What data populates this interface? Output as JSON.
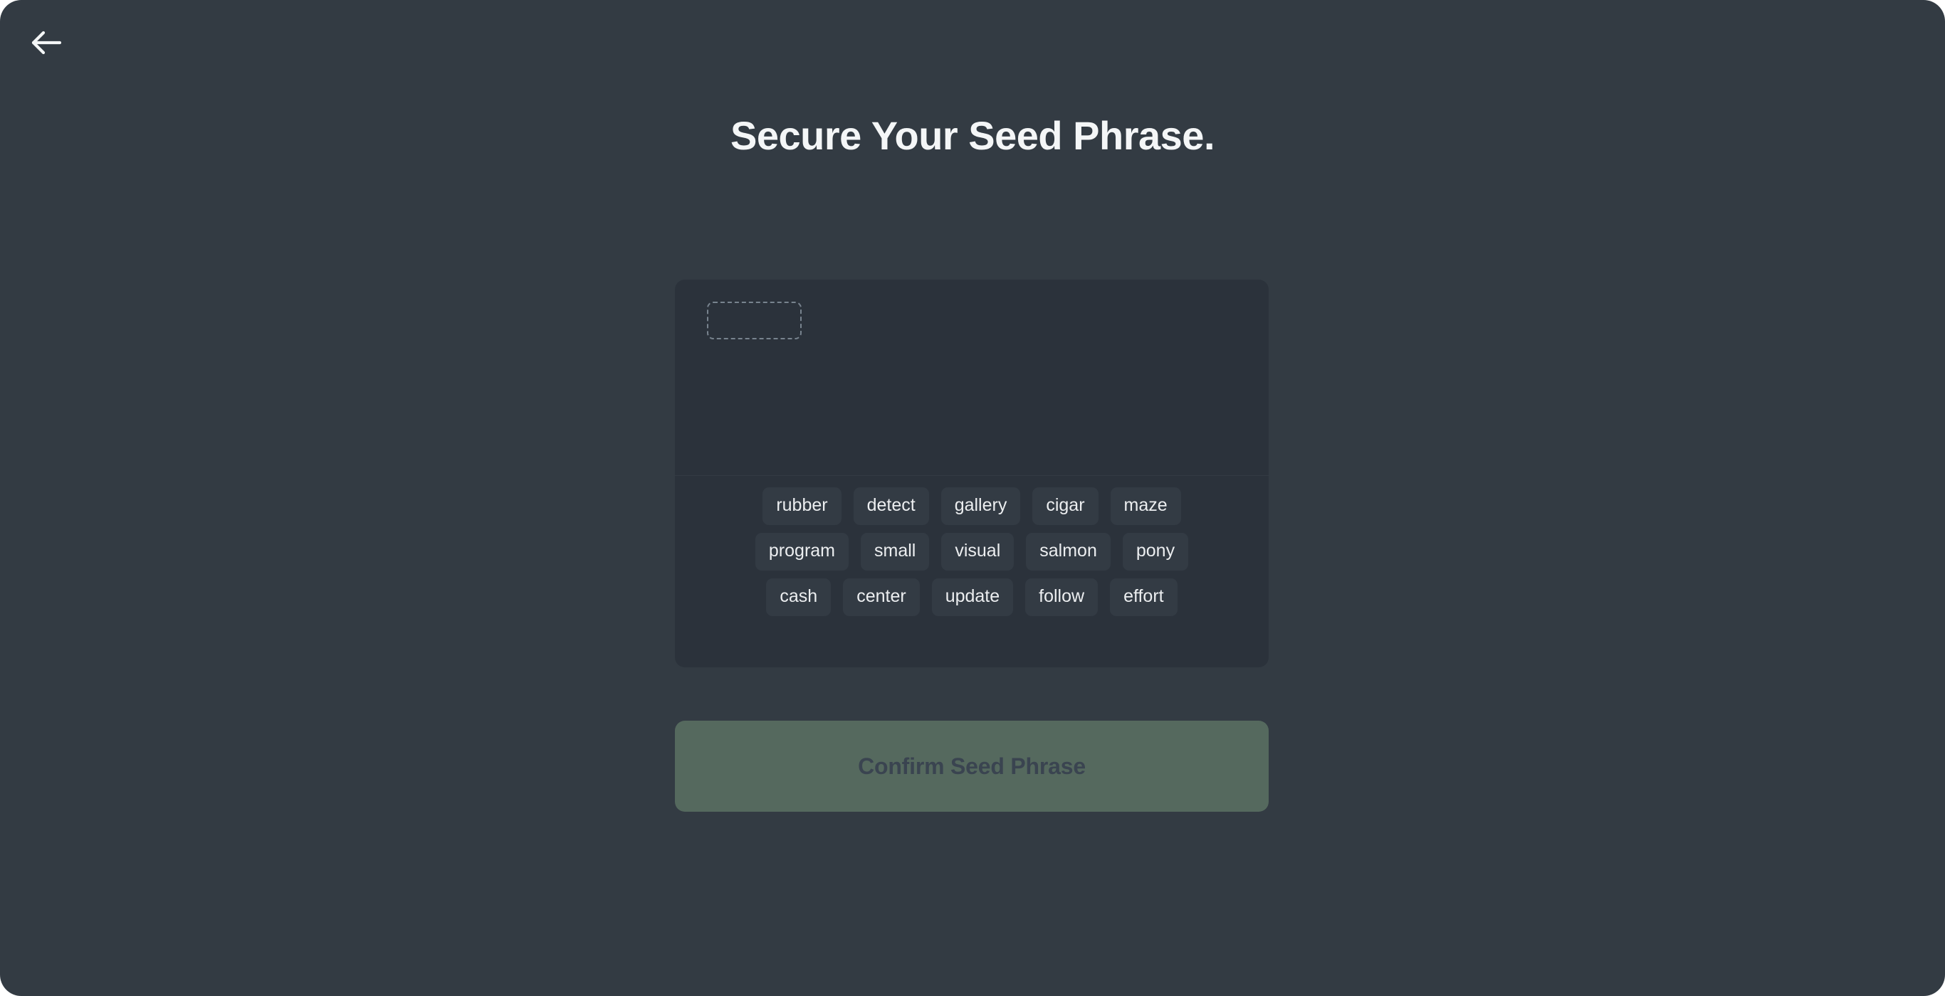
{
  "theme": {
    "page_bg": "#333b43",
    "card_bg": "#2b323b",
    "chip_bg": "#333b44",
    "chip_text": "#eceef0",
    "title_color": "#f4f6f7",
    "slot_border": "#78838e",
    "confirm_bg": "#55695e",
    "confirm_text": "#3a4450"
  },
  "header": {
    "back_icon": "arrow-left-icon",
    "title": "Secure Your Seed Phrase."
  },
  "seed_builder": {
    "selected_words": [],
    "empty_slot_count": 1,
    "word_bank_rows": [
      [
        "rubber",
        "detect",
        "gallery",
        "cigar",
        "maze"
      ],
      [
        "program",
        "small",
        "visual",
        "salmon",
        "pony"
      ],
      [
        "cash",
        "center",
        "update",
        "follow",
        "effort"
      ]
    ]
  },
  "footer": {
    "confirm_label": "Confirm Seed Phrase",
    "confirm_disabled": true
  }
}
